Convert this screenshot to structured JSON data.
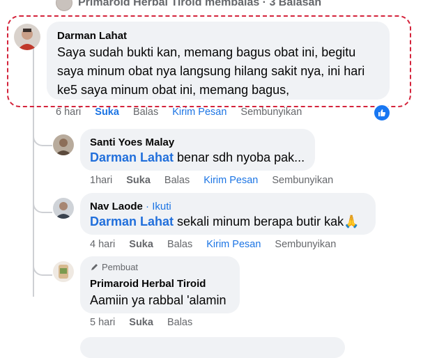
{
  "header": {
    "text": "Primaroid Herbal Tiroid membalas · 3 Balasan"
  },
  "main_comment": {
    "author": "Darman Lahat",
    "text": "Saya sudah bukti kan, memang bagus obat ini, begitu saya minum obat nya langsung hilang sakit nya, ini hari ke5 saya minum obat ini, memang bagus,",
    "time": "6 hari",
    "like": "Suka",
    "reply": "Balas",
    "message": "Kirim Pesan",
    "hide": "Sembunyikan",
    "reaction_icon": "thumbs-up-icon"
  },
  "replies": [
    {
      "author": "Santi Yoes Malay",
      "mention": "Darman Lahat",
      "text": " benar sdh nyoba pak...",
      "time": "1hari",
      "like": "Suka",
      "reply": "Balas",
      "message": "Kirim Pesan",
      "hide": "Sembunyikan"
    },
    {
      "author": "Nav Laode",
      "follow": "· Ikuti",
      "mention": "Darman Lahat",
      "text": " sekali minum berapa butir kak🙏",
      "time": "4 hari",
      "like": "Suka",
      "reply": "Balas",
      "message": "Kirim Pesan",
      "hide": "Sembunyikan"
    },
    {
      "badge": "Pembuat",
      "author": "Primaroid Herbal Tiroid",
      "text": "Aamiin ya rabbal 'alamin",
      "time": "5 hari",
      "like": "Suka",
      "reply": "Balas"
    }
  ],
  "colors": {
    "mention": "#216fdb",
    "highlight_border": "#d4233b",
    "bubble": "#f0f2f5"
  }
}
